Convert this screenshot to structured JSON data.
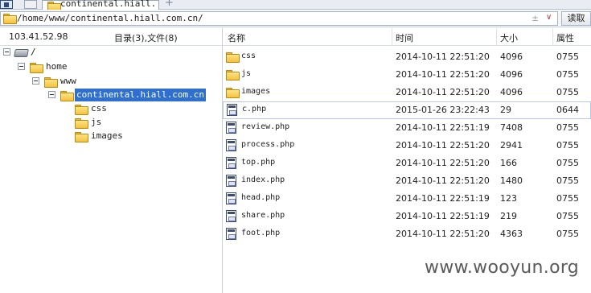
{
  "tab": {
    "title": "continental.hiall..."
  },
  "address": {
    "path": "/home/www/continental.hiall.com.cn/",
    "pm": "±",
    "dropdown": "∨",
    "read_label": "读取"
  },
  "left_header": {
    "ip": "103.41.52.98",
    "count": "目录(3),文件(8)"
  },
  "columns": {
    "name": "名称",
    "time": "时间",
    "size": "大小",
    "attr": "属性"
  },
  "tree": [
    {
      "label": "/",
      "icon": "drive-icon"
    },
    {
      "label": "home",
      "icon": "folder-icon"
    },
    {
      "label": "www",
      "icon": "folder-icon"
    },
    {
      "label": "continental.hiall.com.cn",
      "icon": "folder-icon",
      "selected": true
    },
    {
      "label": "css",
      "icon": "folder-icon"
    },
    {
      "label": "js",
      "icon": "folder-icon"
    },
    {
      "label": "images",
      "icon": "folder-icon"
    }
  ],
  "files": [
    {
      "name": "css",
      "time": "2014-10-11 22:51:20",
      "size": "4096",
      "attr": "0755",
      "icon": "folder-icon"
    },
    {
      "name": "js",
      "time": "2014-10-11 22:51:20",
      "size": "4096",
      "attr": "0755",
      "icon": "folder-icon"
    },
    {
      "name": "images",
      "time": "2014-10-11 22:51:20",
      "size": "4096",
      "attr": "0755",
      "icon": "folder-icon"
    },
    {
      "name": "c.php",
      "time": "2015-01-26 23:22:43",
      "size": "29",
      "attr": "0644",
      "icon": "php-file-icon"
    },
    {
      "name": "review.php",
      "time": "2014-10-11 22:51:19",
      "size": "7408",
      "attr": "0755",
      "icon": "php-file-icon"
    },
    {
      "name": "process.php",
      "time": "2014-10-11 22:51:20",
      "size": "2941",
      "attr": "0755",
      "icon": "php-file-icon"
    },
    {
      "name": "top.php",
      "time": "2014-10-11 22:51:20",
      "size": "166",
      "attr": "0755",
      "icon": "php-file-icon"
    },
    {
      "name": "index.php",
      "time": "2014-10-11 22:51:20",
      "size": "1480",
      "attr": "0755",
      "icon": "php-file-icon"
    },
    {
      "name": "head.php",
      "time": "2014-10-11 22:51:19",
      "size": "123",
      "attr": "0755",
      "icon": "php-file-icon"
    },
    {
      "name": "share.php",
      "time": "2014-10-11 22:51:19",
      "size": "219",
      "attr": "0755",
      "icon": "php-file-icon"
    },
    {
      "name": "foot.php",
      "time": "2014-10-11 22:51:20",
      "size": "4363",
      "attr": "0755",
      "icon": "php-file-icon"
    }
  ],
  "watermark": "www.wooyun.org",
  "colors": {
    "selection": "#2f6fcf",
    "folder": "#f3c23e"
  }
}
